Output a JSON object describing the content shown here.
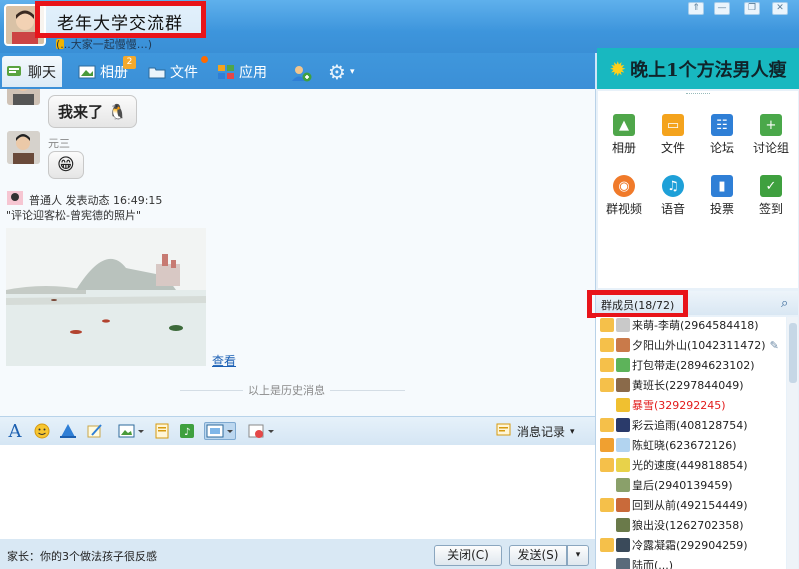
{
  "window": {
    "group_name": "老年大学交流群",
    "subtitle": "(...大家一起慢慢…)",
    "controls": [
      "⇑",
      "—",
      "❐",
      "✕"
    ]
  },
  "tabs": [
    {
      "label": "聊天",
      "icon": "chat-icon",
      "active": true
    },
    {
      "label": "相册",
      "icon": "photo-icon",
      "badge": "2"
    },
    {
      "label": "文件",
      "icon": "folder-icon"
    },
    {
      "label": "应用",
      "icon": "apps-icon"
    }
  ],
  "tab_extras": {
    "add_member_icon": "add-member-icon",
    "settings_icon": "gear-icon"
  },
  "ad": {
    "text": "晚上1个方法男人瘦"
  },
  "chat": {
    "msg1": "我来了",
    "sender2": "元三",
    "post_header": "普通人  发表动态  16:49:15",
    "post_caption": "\"评论迎客松-曾宪德的照片\"",
    "view_link": "查看",
    "history_divider": "以上是历史消息"
  },
  "toolbar": {
    "history_label": "消息记录"
  },
  "bottom": {
    "status_message": "家长：你的3个做法孩子很反感",
    "close_label": "关闭(C)",
    "send_label": "发送(S)"
  },
  "apps": [
    {
      "label": "相册",
      "color": "#4fa64a",
      "icon": "album-app-icon"
    },
    {
      "label": "文件",
      "color": "#f4a31d",
      "icon": "file-app-icon"
    },
    {
      "label": "论坛",
      "color": "#2f7fd6",
      "icon": "forum-app-icon"
    },
    {
      "label": "讨论组",
      "color": "#4aa84a",
      "icon": "discussion-app-icon"
    },
    {
      "label": "群视频",
      "color": "#f07a2a",
      "icon": "video-app-icon"
    },
    {
      "label": "语音",
      "color": "#1ea0d8",
      "icon": "voice-app-icon"
    },
    {
      "label": "投票",
      "color": "#2f7fd6",
      "icon": "vote-app-icon"
    },
    {
      "label": "签到",
      "color": "#3fa03f",
      "icon": "checkin-app-icon"
    }
  ],
  "members": {
    "title": "群成员(18/72)",
    "list": [
      {
        "name": "来萌-李萌(2964584418)",
        "color": "#222"
      },
      {
        "name": "夕阳山外山(1042311472)",
        "color": "#222"
      },
      {
        "name": "打包带走(2894623102)",
        "color": "#222"
      },
      {
        "name": "黄班长(2297844049)",
        "color": "#222"
      },
      {
        "name": "暴雪(329292245)",
        "color": "#e21b1b"
      },
      {
        "name": "彩云追雨(408128754)",
        "color": "#222"
      },
      {
        "name": "陈虹晓(623672126)",
        "color": "#222"
      },
      {
        "name": "光的速度(449818854)",
        "color": "#222"
      },
      {
        "name": "皇后(2940139459)",
        "color": "#222"
      },
      {
        "name": "回到从前(492154449)",
        "color": "#222"
      },
      {
        "name": "狼出没(1262702358)",
        "color": "#222"
      },
      {
        "name": "冷露凝霜(292904259)",
        "color": "#222"
      },
      {
        "name": "陆而(...)",
        "color": "#222"
      }
    ]
  }
}
